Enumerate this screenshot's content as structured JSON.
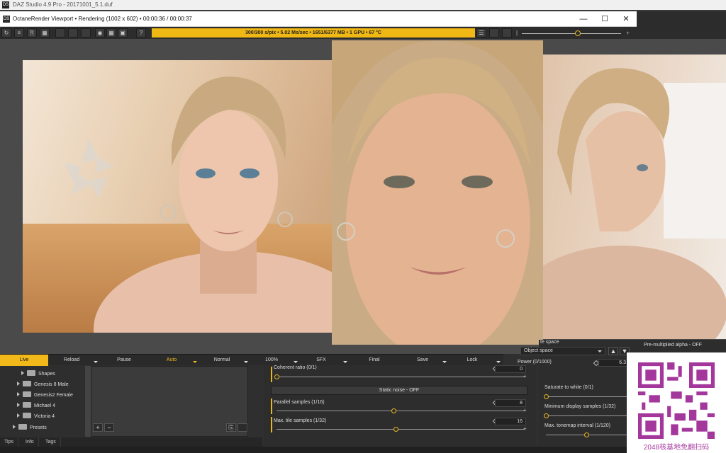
{
  "app": {
    "window_title": "DAZ Studio 4.9 Pro - 20171001_5.1.duf",
    "logo_text": "DS"
  },
  "octane_window": {
    "title": "OctaneRender Viewport • Rendering (1002 x 602) • 00:00:36 / 00:00:37",
    "status": "300/300 s/pix • 5.02 Ms/sec • 1651/6377 MB • 1 GPU • 67 °C",
    "window_buttons": [
      "—",
      "☐",
      "✕"
    ],
    "toolbar_icons": [
      "refresh-icon",
      "settings-list-icon",
      "export-icon",
      "gallery-icon",
      "record-icon",
      "grid-icon",
      "image-icon",
      "help-icon"
    ],
    "top_slider_fraction": 0.56
  },
  "playbar": {
    "items": [
      {
        "label": "Live",
        "state": "active"
      },
      {
        "label": "Reload",
        "state": "normal"
      },
      {
        "label": "Pause",
        "state": "normal"
      },
      {
        "label": "Auto",
        "state": "auto"
      },
      {
        "label": "Normal",
        "state": "normal"
      },
      {
        "label": "100%",
        "state": "normal"
      },
      {
        "label": "SFX",
        "state": "normal"
      },
      {
        "label": "Final",
        "state": "normal"
      },
      {
        "label": "Save",
        "state": "normal"
      },
      {
        "label": "Lock",
        "state": "normal"
      }
    ]
  },
  "tree": {
    "items": [
      "Shapes",
      "Genesis 8 Male",
      "Genesis2 Female",
      "Michael 4",
      "Victoria 4",
      "Presets"
    ]
  },
  "tabs": [
    "Tips",
    "Info",
    "Tags"
  ],
  "settings": {
    "coherent_ratio": {
      "label": "Coherent ratio (0/1)",
      "value": "0",
      "fraction": 0.0
    },
    "static_noise": "Static noise - OFF",
    "parallel_samples": {
      "label": "Parallel samples (1/16)",
      "value": "8",
      "fraction": 0.47
    },
    "max_tile_samples": {
      "label": "Max. tile samples (1/32)",
      "value": "16",
      "fraction": 0.48
    }
  },
  "right_settings": {
    "space_label": "te space",
    "object_space": "Object space",
    "pre_multiplied_alpha": "Pre-multiplied alpha - OFF",
    "power_label": "Power (0/1000)",
    "power_value": "6.3",
    "saturate_to_white": {
      "label": "Saturate to white (0/1)",
      "fraction": 0.0
    },
    "min_display_samples": {
      "label": "Minimum display samples (1/32)",
      "fraction": 0.0
    },
    "max_tonemap_interval": {
      "label": "Max. tonemap interval (1/120)",
      "fraction": 0.5
    }
  },
  "watermark": {
    "caption": "2048核基地免翻扫码"
  }
}
